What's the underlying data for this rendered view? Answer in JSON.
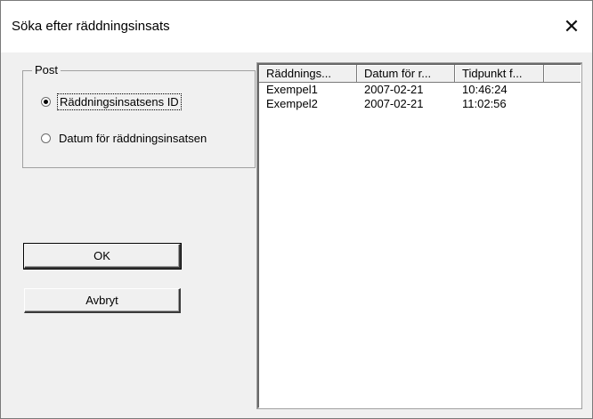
{
  "window": {
    "title": "Söka efter räddningsinsats",
    "close_glyph": "✕"
  },
  "group": {
    "legend": "Post",
    "options": [
      {
        "label": "Räddningsinsatsens ID",
        "selected": true
      },
      {
        "label": "Datum för räddningsinsatsen",
        "selected": false
      }
    ]
  },
  "buttons": {
    "ok": "OK",
    "cancel": "Avbryt"
  },
  "list": {
    "columns": [
      "Räddnings...",
      "Datum för r...",
      "Tidpunkt f..."
    ],
    "rows": [
      [
        "Exempel1",
        "2007-02-21",
        "10:46:24"
      ],
      [
        "Exempel2",
        "2007-02-21",
        "11:02:56"
      ]
    ]
  }
}
